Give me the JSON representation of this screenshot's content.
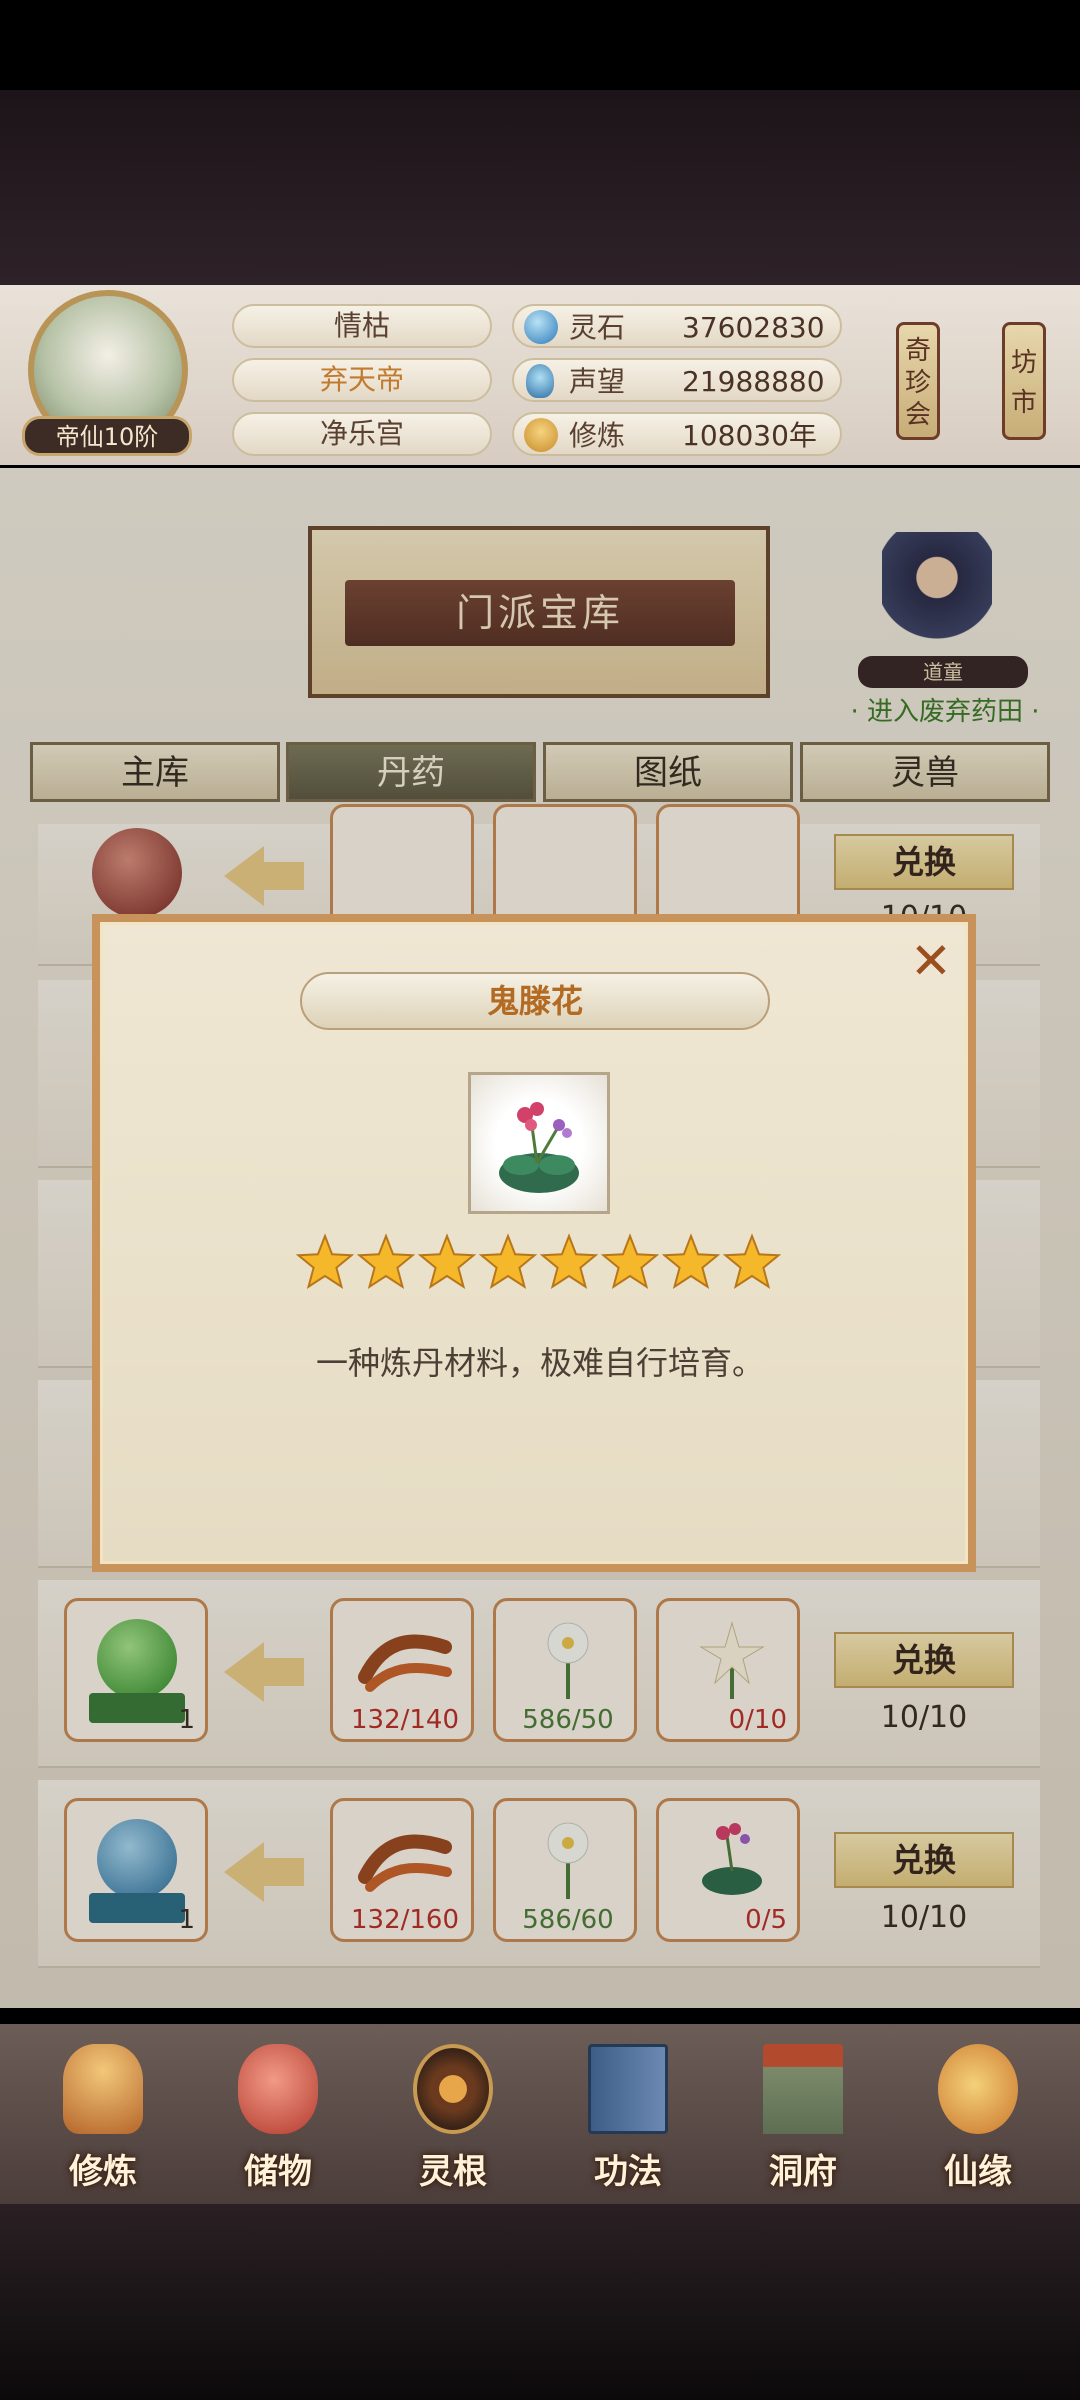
{
  "header": {
    "rank": "帝仙10阶",
    "names": [
      "情枯",
      "弃天帝",
      "净乐宫"
    ],
    "stats": [
      {
        "label": "灵石",
        "value": "37602830",
        "icon": "spirit-stone-icon"
      },
      {
        "label": "声望",
        "value": "21988880",
        "icon": "reputation-icon"
      },
      {
        "label": "修炼",
        "value": "108030年",
        "icon": "cultivation-icon"
      }
    ],
    "lantern_left": "奇珍会",
    "lantern_right": "坊市"
  },
  "treasury": {
    "title": "门派宝库",
    "npc_tag": "道童",
    "npc_link": "· 进入废弃药田 ·"
  },
  "tabs": [
    "主库",
    "丹药",
    "图纸",
    "灵兽"
  ],
  "active_tab_index": 1,
  "rows": [
    {
      "result_count": "1",
      "materials": [
        {
          "count": "132/140",
          "state": "insufficient"
        },
        {
          "count": "586/50",
          "state": "enough"
        },
        {
          "count": "0/10",
          "state": "insufficient"
        }
      ],
      "button": "兑换",
      "limit": "10/10"
    },
    {
      "result_count": "1",
      "materials": [
        {
          "count": "132/160",
          "state": "insufficient"
        },
        {
          "count": "586/60",
          "state": "enough"
        },
        {
          "count": "0/5",
          "state": "insufficient"
        }
      ],
      "button": "兑换",
      "limit": "10/10"
    }
  ],
  "top_row": {
    "button": "兑换",
    "limit": "10/10"
  },
  "modal": {
    "title": "鬼滕花",
    "stars": 8,
    "description": "一种炼丹材料，极难自行培育。",
    "close_icon": "close-icon"
  },
  "nav": [
    "修炼",
    "储物",
    "灵根",
    "功法",
    "洞府",
    "仙缘"
  ],
  "colors": {
    "accent": "#b36a22",
    "frame": "#c8935a",
    "insufficient": "#b8322a",
    "enough": "#4e7d3a"
  }
}
